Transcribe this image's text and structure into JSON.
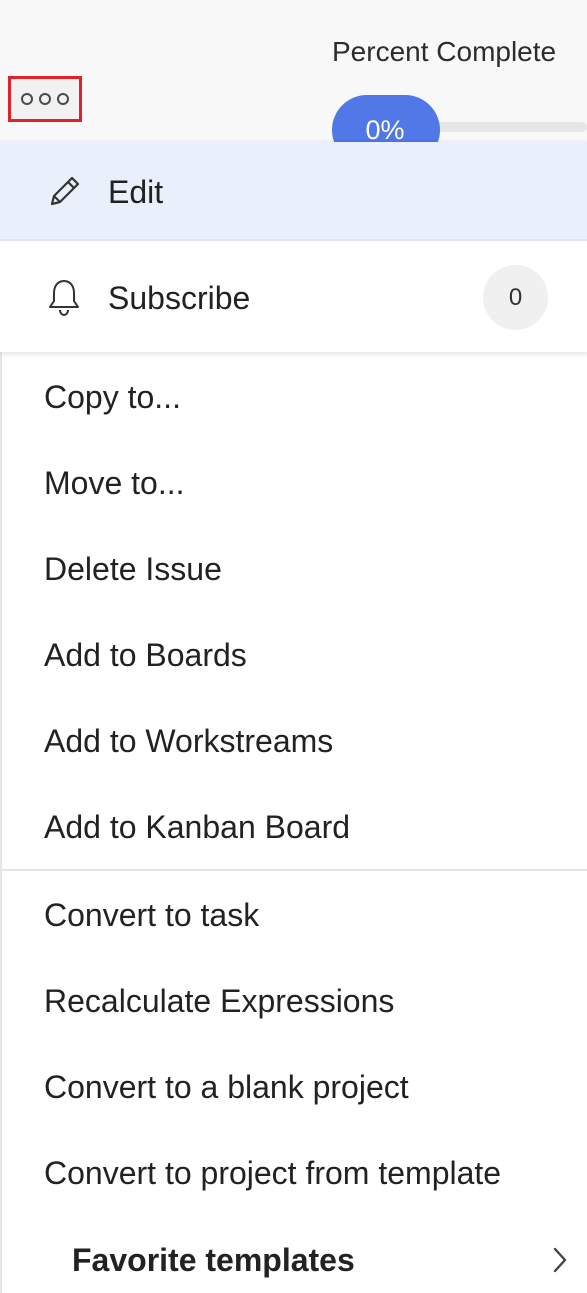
{
  "header": {
    "more_button_icon": "more-horizontal-icon",
    "percent_label": "Percent Complete",
    "progress": {
      "value_text": "0%",
      "value": 0,
      "color": "#5078e6"
    },
    "highlight_color": "#e0232b"
  },
  "menu": {
    "edit": {
      "icon": "pencil-icon",
      "label": "Edit"
    },
    "subscribe": {
      "icon": "bell-icon",
      "label": "Subscribe",
      "count": "0"
    },
    "items": [
      "Copy to...",
      "Move to...",
      "Delete Issue",
      "Add to Boards",
      "Add to Workstreams",
      "Add to Kanban Board"
    ],
    "convert_items": [
      "Convert to task",
      "Recalculate Expressions",
      "Convert to a blank project",
      "Convert to project from template"
    ],
    "submenu": {
      "label": "Favorite templates",
      "icon": "chevron-right-icon"
    }
  }
}
